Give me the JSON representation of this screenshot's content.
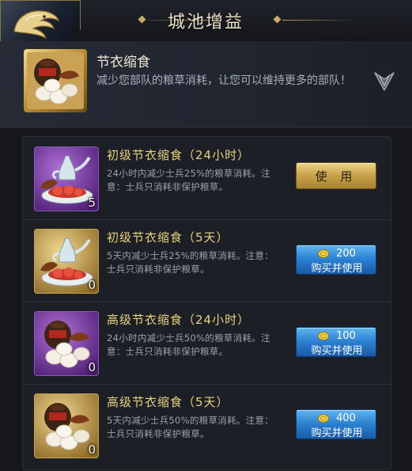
{
  "header": {
    "title": "城池增益"
  },
  "info": {
    "title": "节衣缩食",
    "description": "减少您部队的粮草消耗，让您可以维持更多的部队！",
    "icon": "jar-and-buns-icon"
  },
  "items": [
    {
      "title": "初级节衣缩食（24小时）",
      "description": "24小时内减少士兵25%的粮草消耗。注意：士兵只消耗非保护粮草。",
      "count": "5",
      "icon": "teapot-feast-icon",
      "frame": "purple",
      "action": {
        "type": "use",
        "label": "使 用"
      }
    },
    {
      "title": "初级节衣缩食（5天）",
      "description": "5天内减少士兵25%的粮草消耗。注意：士兵只消耗非保护粮草。",
      "count": "0",
      "icon": "teapot-feast-icon",
      "frame": "gold",
      "action": {
        "type": "buy",
        "price": "200",
        "label": "购买并使用"
      }
    },
    {
      "title": "高级节衣缩食（24小时）",
      "description": "24小时内减少士兵50%的粮草消耗。注意：士兵只消耗非保护粮草。",
      "count": "0",
      "icon": "jar-and-buns-icon",
      "frame": "purple",
      "action": {
        "type": "buy",
        "price": "100",
        "label": "购买并使用"
      }
    },
    {
      "title": "高级节衣缩食（5天）",
      "description": "5天内减少士兵50%的粮草消耗。注意：士兵只消耗非保护粮草。",
      "count": "0",
      "icon": "jar-and-buns-icon",
      "frame": "gold",
      "action": {
        "type": "buy",
        "price": "400",
        "label": "购买并使用"
      }
    }
  ],
  "colors": {
    "item_title": "#e8d27e",
    "use_button": "#c9a44e",
    "buy_button": "#2a7fd0"
  }
}
